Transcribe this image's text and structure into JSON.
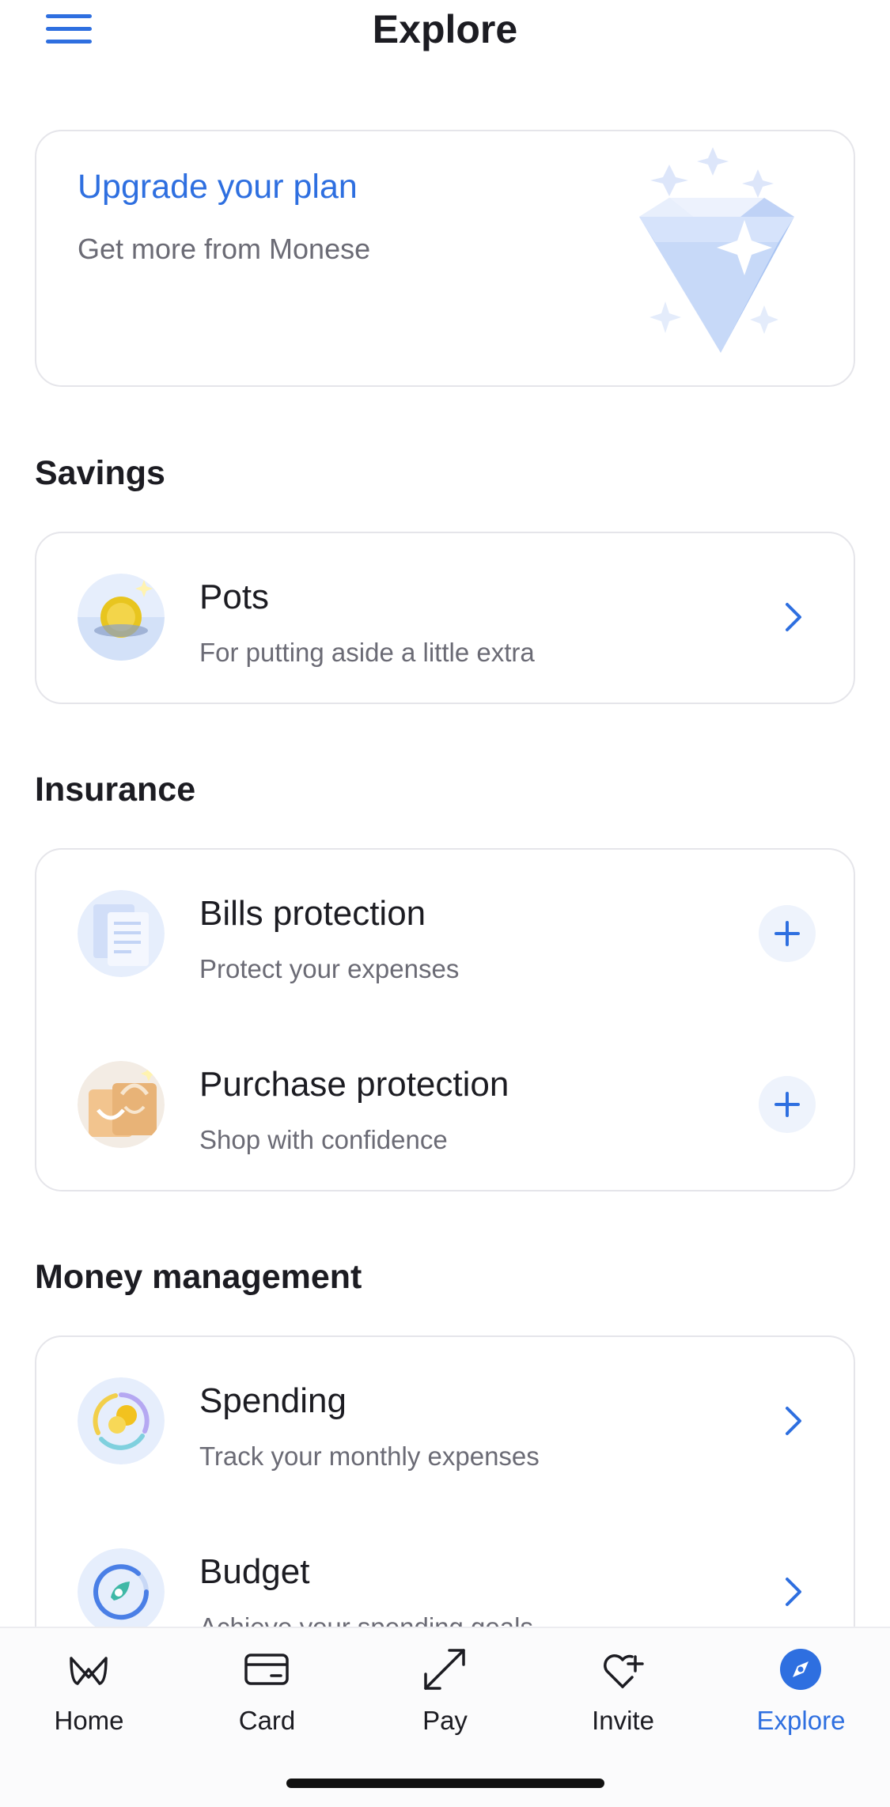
{
  "header": {
    "title": "Explore",
    "menu_icon": "hamburger-menu-icon"
  },
  "upgrade": {
    "title": "Upgrade your plan",
    "subtitle": "Get more from Monese",
    "illustration": "diamond-icon"
  },
  "sections": {
    "savings": {
      "title": "Savings",
      "items": [
        {
          "title": "Pots",
          "subtitle": "For putting aside a little extra",
          "icon": "pots-icon",
          "action": "chevron-right-icon"
        }
      ]
    },
    "insurance": {
      "title": "Insurance",
      "items": [
        {
          "title": "Bills protection",
          "subtitle": "Protect your expenses",
          "icon": "bills-protection-icon",
          "action": "plus-icon"
        },
        {
          "title": "Purchase protection",
          "subtitle": "Shop with confidence",
          "icon": "purchase-protection-icon",
          "action": "plus-icon"
        }
      ]
    },
    "money_management": {
      "title": "Money management",
      "items": [
        {
          "title": "Spending",
          "subtitle": "Track your monthly expenses",
          "icon": "spending-icon",
          "action": "chevron-right-icon"
        },
        {
          "title": "Budget",
          "subtitle": "Achieve your spending goals",
          "icon": "budget-icon",
          "action": "chevron-right-icon"
        }
      ]
    }
  },
  "tabbar": {
    "tabs": [
      {
        "label": "Home",
        "icon": "monese-logo-icon",
        "active": false
      },
      {
        "label": "Card",
        "icon": "card-icon",
        "active": false
      },
      {
        "label": "Pay",
        "icon": "pay-arrows-icon",
        "active": false
      },
      {
        "label": "Invite",
        "icon": "heart-plus-icon",
        "active": false
      },
      {
        "label": "Explore",
        "icon": "compass-icon",
        "active": true
      }
    ]
  },
  "colors": {
    "accent": "#2e6fe0",
    "text": "#1c1c22",
    "muted": "#6b6b75",
    "border": "#e5e5ea"
  }
}
